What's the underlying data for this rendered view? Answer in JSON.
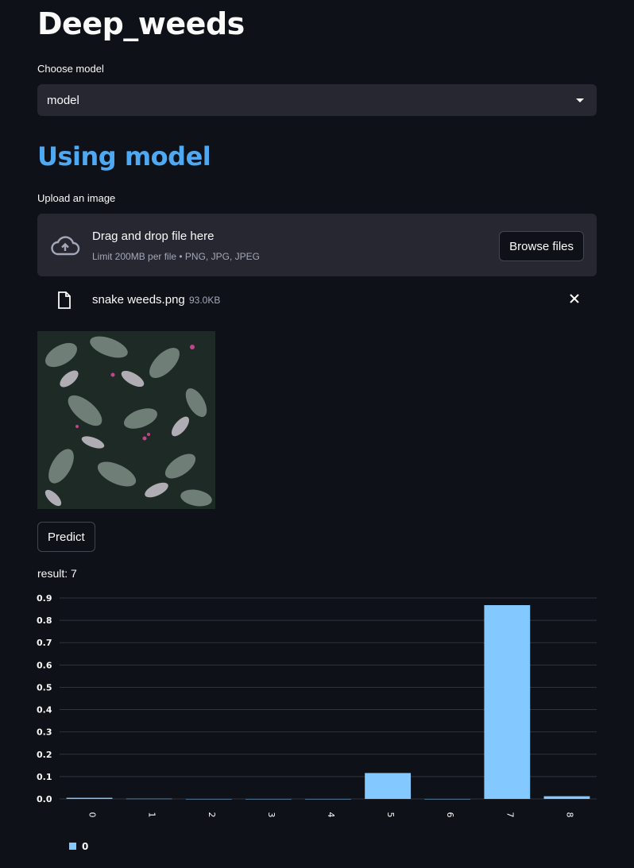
{
  "app": {
    "title": "Deep_weeds"
  },
  "model_select": {
    "label": "Choose model",
    "value": "model"
  },
  "section": {
    "heading": "Using model"
  },
  "uploader": {
    "label": "Upload an image",
    "title": "Drag and drop file here",
    "hint": "Limit 200MB per file • PNG, JPG, JPEG",
    "browse_label": "Browse files"
  },
  "uploaded_file": {
    "name": "snake weeds.png",
    "size": "93.0KB"
  },
  "predict_label": "Predict",
  "result_text": "result: 7",
  "colors": {
    "accent": "#4ea8f2",
    "bar": "#83c9ff",
    "background": "#0e1117"
  },
  "chart_data": {
    "type": "bar",
    "categories": [
      "0",
      "1",
      "2",
      "3",
      "4",
      "5",
      "6",
      "7",
      "8"
    ],
    "series": [
      {
        "name": "0",
        "values": [
          0.005,
          0.001,
          0.0,
          0.0,
          0.0,
          0.116,
          0.0,
          0.868,
          0.012
        ]
      }
    ],
    "ylim": [
      0,
      0.9
    ],
    "yticks": [
      "0.0",
      "0.1",
      "0.2",
      "0.3",
      "0.4",
      "0.5",
      "0.6",
      "0.7",
      "0.8",
      "0.9"
    ],
    "grid": true,
    "legend": "bottom-left"
  }
}
